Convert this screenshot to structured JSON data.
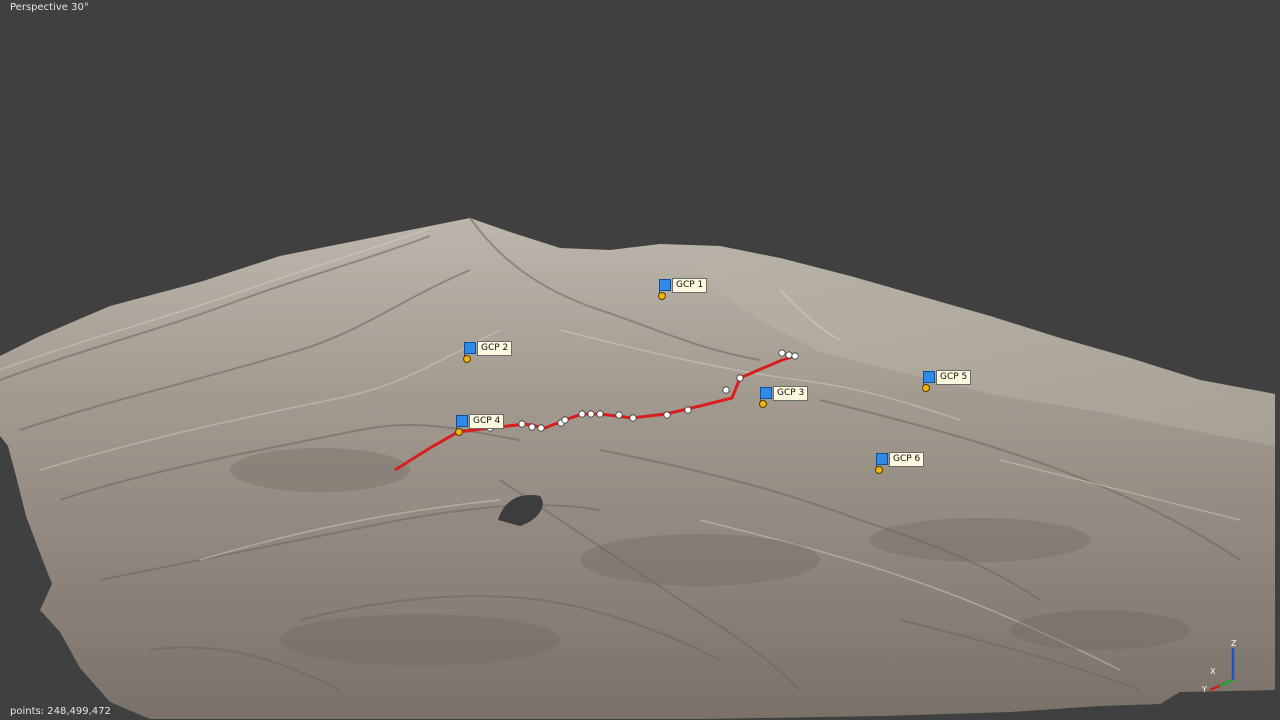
{
  "viewport": {
    "view_label": "Perspective 30°",
    "points_label": "points: 248,499,472",
    "background_color": "#404040"
  },
  "markers": [
    {
      "label": "GCP 1"
    },
    {
      "label": "GCP 2"
    },
    {
      "label": "GCP 3"
    },
    {
      "label": "GCP 4"
    },
    {
      "label": "GCP 5"
    },
    {
      "label": "GCP 6"
    }
  ],
  "gizmo": {
    "z": "Z",
    "x": "X",
    "y": "Y"
  },
  "colors": {
    "flag": "#2f8ae8",
    "pin": "#f1b410",
    "polyline": "#d81e1e",
    "vertex": "#ffffff"
  }
}
